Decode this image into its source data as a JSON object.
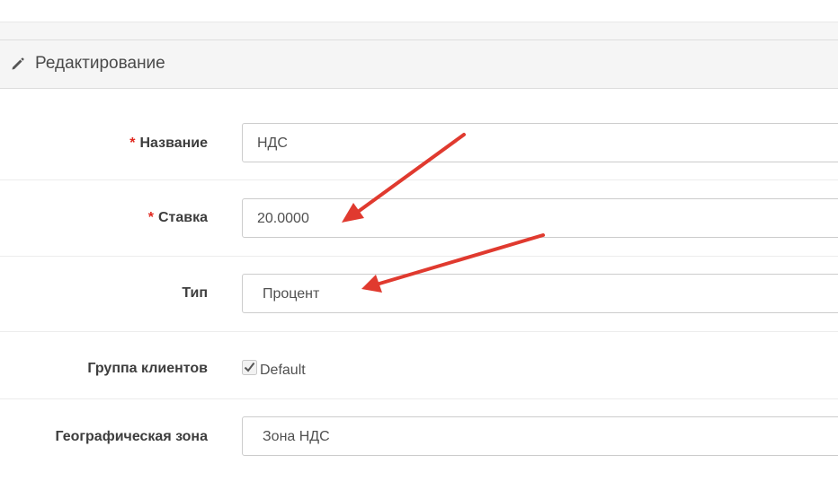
{
  "header": {
    "title": "Редактирование",
    "icon": "pencil-icon"
  },
  "form": {
    "required_mark": "*",
    "name": {
      "label": "Название",
      "value": "НДС"
    },
    "rate": {
      "label": "Ставка",
      "value": "20.0000"
    },
    "type": {
      "label": "Тип",
      "value": "Процент"
    },
    "customer_group": {
      "label": "Группа клиентов",
      "option": "Default",
      "checked": true
    },
    "geo_zone": {
      "label": "Географическая зона",
      "value": "Зона НДС"
    }
  },
  "colors": {
    "required": "#e0261d",
    "arrow": "#e03a2f",
    "heading_bg": "#f5f5f5",
    "border": "#cccccc"
  }
}
